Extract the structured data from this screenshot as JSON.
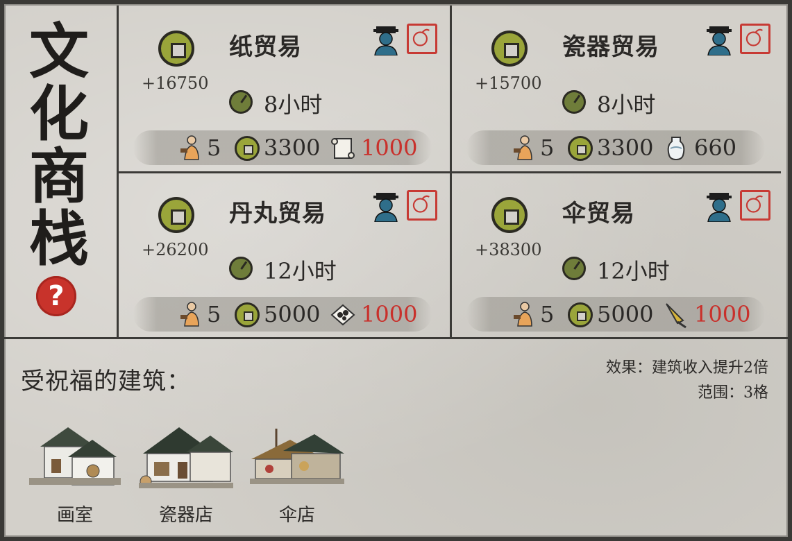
{
  "panel": {
    "title_chars": [
      "文",
      "化",
      "商",
      "栈"
    ],
    "help_icon": "question-icon",
    "help_symbol": "?"
  },
  "trades": [
    {
      "name": "纸贸易",
      "income": "+16750",
      "duration": "8小时",
      "workers": "5",
      "coin_cost": "3300",
      "resource_icon": "paper-scroll-icon",
      "resource_cost": "1000",
      "resource_cost_insufficient": true
    },
    {
      "name": "瓷器贸易",
      "income": "+15700",
      "duration": "8小时",
      "workers": "5",
      "coin_cost": "3300",
      "resource_icon": "porcelain-vase-icon",
      "resource_cost": "660",
      "resource_cost_insufficient": false
    },
    {
      "name": "丹丸贸易",
      "income": "+26200",
      "duration": "12小时",
      "workers": "5",
      "coin_cost": "5000",
      "resource_icon": "pill-icon",
      "resource_cost": "1000",
      "resource_cost_insufficient": true
    },
    {
      "name": "伞贸易",
      "income": "+38300",
      "duration": "12小时",
      "workers": "5",
      "coin_cost": "5000",
      "resource_icon": "umbrella-icon",
      "resource_cost": "1000",
      "resource_cost_insufficient": true
    }
  ],
  "blessing": {
    "label": "受祝福的建筑：",
    "effect": "效果：建筑收入提升2倍",
    "range": "范围：3格",
    "buildings": [
      {
        "name": "画室",
        "icon": "painting-studio-icon"
      },
      {
        "name": "瓷器店",
        "icon": "porcelain-shop-icon"
      },
      {
        "name": "伞店",
        "icon": "umbrella-shop-icon"
      }
    ]
  },
  "colors": {
    "background": "#d3d0ca",
    "coin": "#9aa53a",
    "npc": "#2f6e8a",
    "seal": "#c73a34",
    "insufficient": "#c9302b",
    "help": "#c8332b"
  }
}
